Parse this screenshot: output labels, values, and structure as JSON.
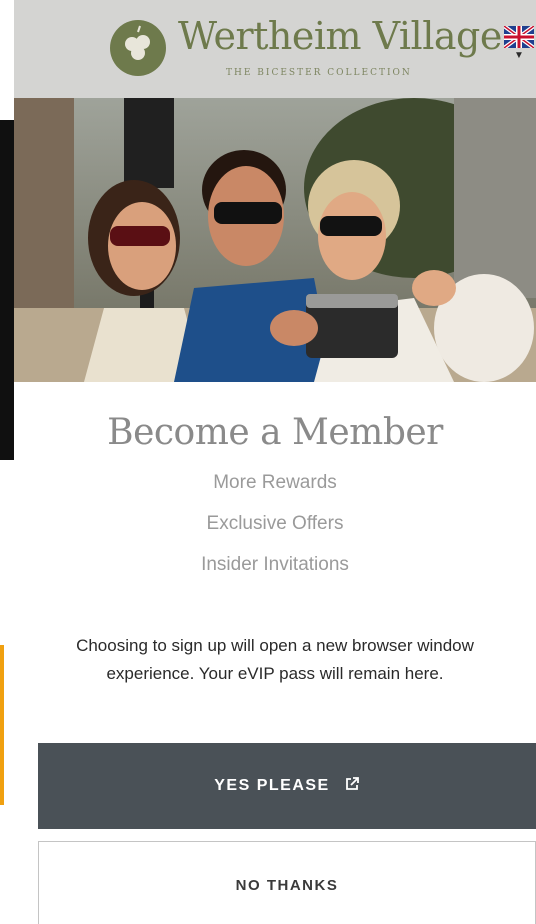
{
  "header": {
    "brand_name": "Wertheim Village",
    "brand_sub": "THE BICESTER COLLECTION",
    "language_icon": "uk-flag-icon"
  },
  "hero": {
    "icon": "hero-photo"
  },
  "member": {
    "title": "Become a Member",
    "perks": [
      "More Rewards",
      "Exclusive Offers",
      "Insider Invitations"
    ],
    "notice": "Choosing to sign up will open a new browser window experience. Your eVIP pass will remain here."
  },
  "actions": {
    "yes_label": "YES PLEASE",
    "yes_icon": "external-link-icon",
    "no_label": "NO THANKS"
  },
  "colors": {
    "brand_green": "#6e7a4c",
    "header_bg": "#d4d4d2",
    "primary_button": "#4a5157",
    "muted_text": "#9a9a9a"
  }
}
